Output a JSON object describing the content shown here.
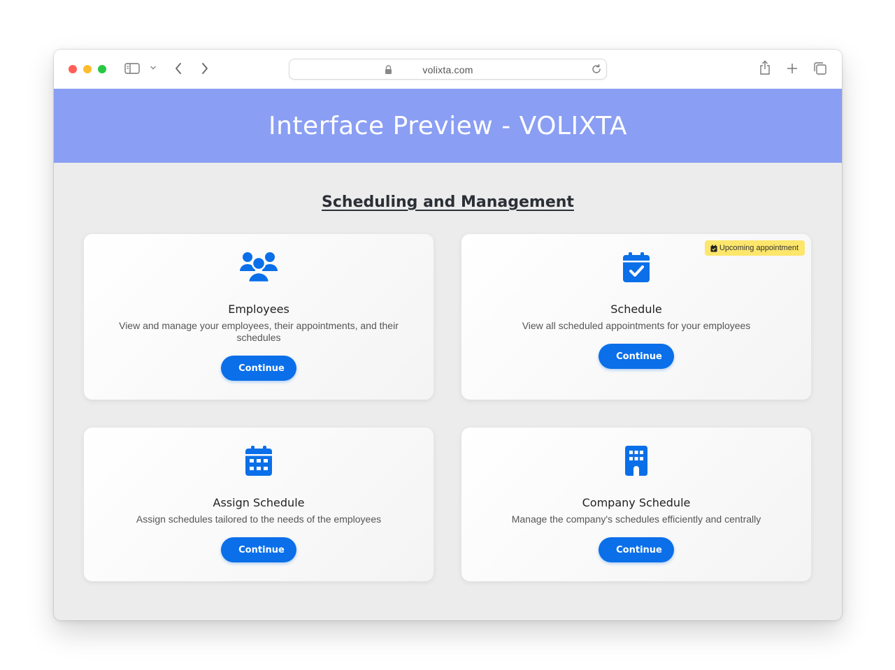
{
  "browser": {
    "url": "volixta.com"
  },
  "banner": {
    "title": "Interface Preview - VOLIXTA"
  },
  "section": {
    "title": "Scheduling and Management"
  },
  "cards": [
    {
      "icon": "users-icon",
      "title": "Employees",
      "description": "View and manage your employees, their appointments, and their schedules",
      "button_label": "Continue"
    },
    {
      "icon": "calendar-check-icon",
      "title": "Schedule",
      "description": "View all scheduled appointments for your employees",
      "button_label": "Continue",
      "badge": "Upcoming appointment"
    },
    {
      "icon": "calendar-days-icon",
      "title": "Assign Schedule",
      "description": "Assign schedules tailored to the needs of the employees",
      "button_label": "Continue"
    },
    {
      "icon": "building-icon",
      "title": "Company Schedule",
      "description": "Manage the company's schedules efficiently and centrally",
      "button_label": "Continue"
    }
  ],
  "colors": {
    "banner": "#8a9ef3",
    "accent": "#0a6fe8",
    "badge": "#fde66b",
    "background": "#ececec"
  }
}
